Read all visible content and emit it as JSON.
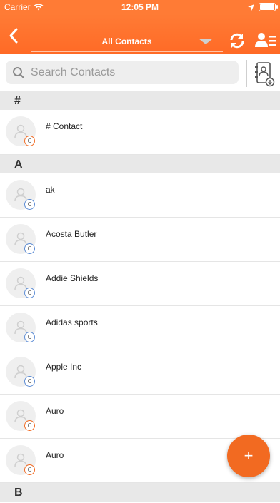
{
  "status_bar": {
    "carrier": "Carrier",
    "time": "12:05 PM"
  },
  "nav": {
    "title": "All Contacts"
  },
  "search": {
    "placeholder": "Search Contacts"
  },
  "sections": [
    {
      "letter": "#",
      "contacts": [
        {
          "name": "# Contact",
          "badge": "C",
          "badge_color": "#f26a21"
        }
      ]
    },
    {
      "letter": "A",
      "contacts": [
        {
          "name": "ak",
          "badge": "C",
          "badge_color": "#5b8bd4"
        },
        {
          "name": "Acosta Butler",
          "badge": "C",
          "badge_color": "#5b8bd4"
        },
        {
          "name": "Addie Shields",
          "badge": "C",
          "badge_color": "#5b8bd4"
        },
        {
          "name": "Adidas sports",
          "badge": "C",
          "badge_color": "#5b8bd4"
        },
        {
          "name": "Apple Inc",
          "badge": "C",
          "badge_color": "#5b8bd4"
        },
        {
          "name": "Auro",
          "badge": "C",
          "badge_color": "#f26a21"
        },
        {
          "name": "Auro",
          "badge": "C",
          "badge_color": "#f26a21"
        }
      ]
    },
    {
      "letter": "B",
      "contacts": []
    }
  ],
  "fab": {
    "label": "+"
  },
  "colors": {
    "accent": "#ff6a26",
    "badge_orange": "#f26a21",
    "badge_blue": "#5b8bd4"
  }
}
